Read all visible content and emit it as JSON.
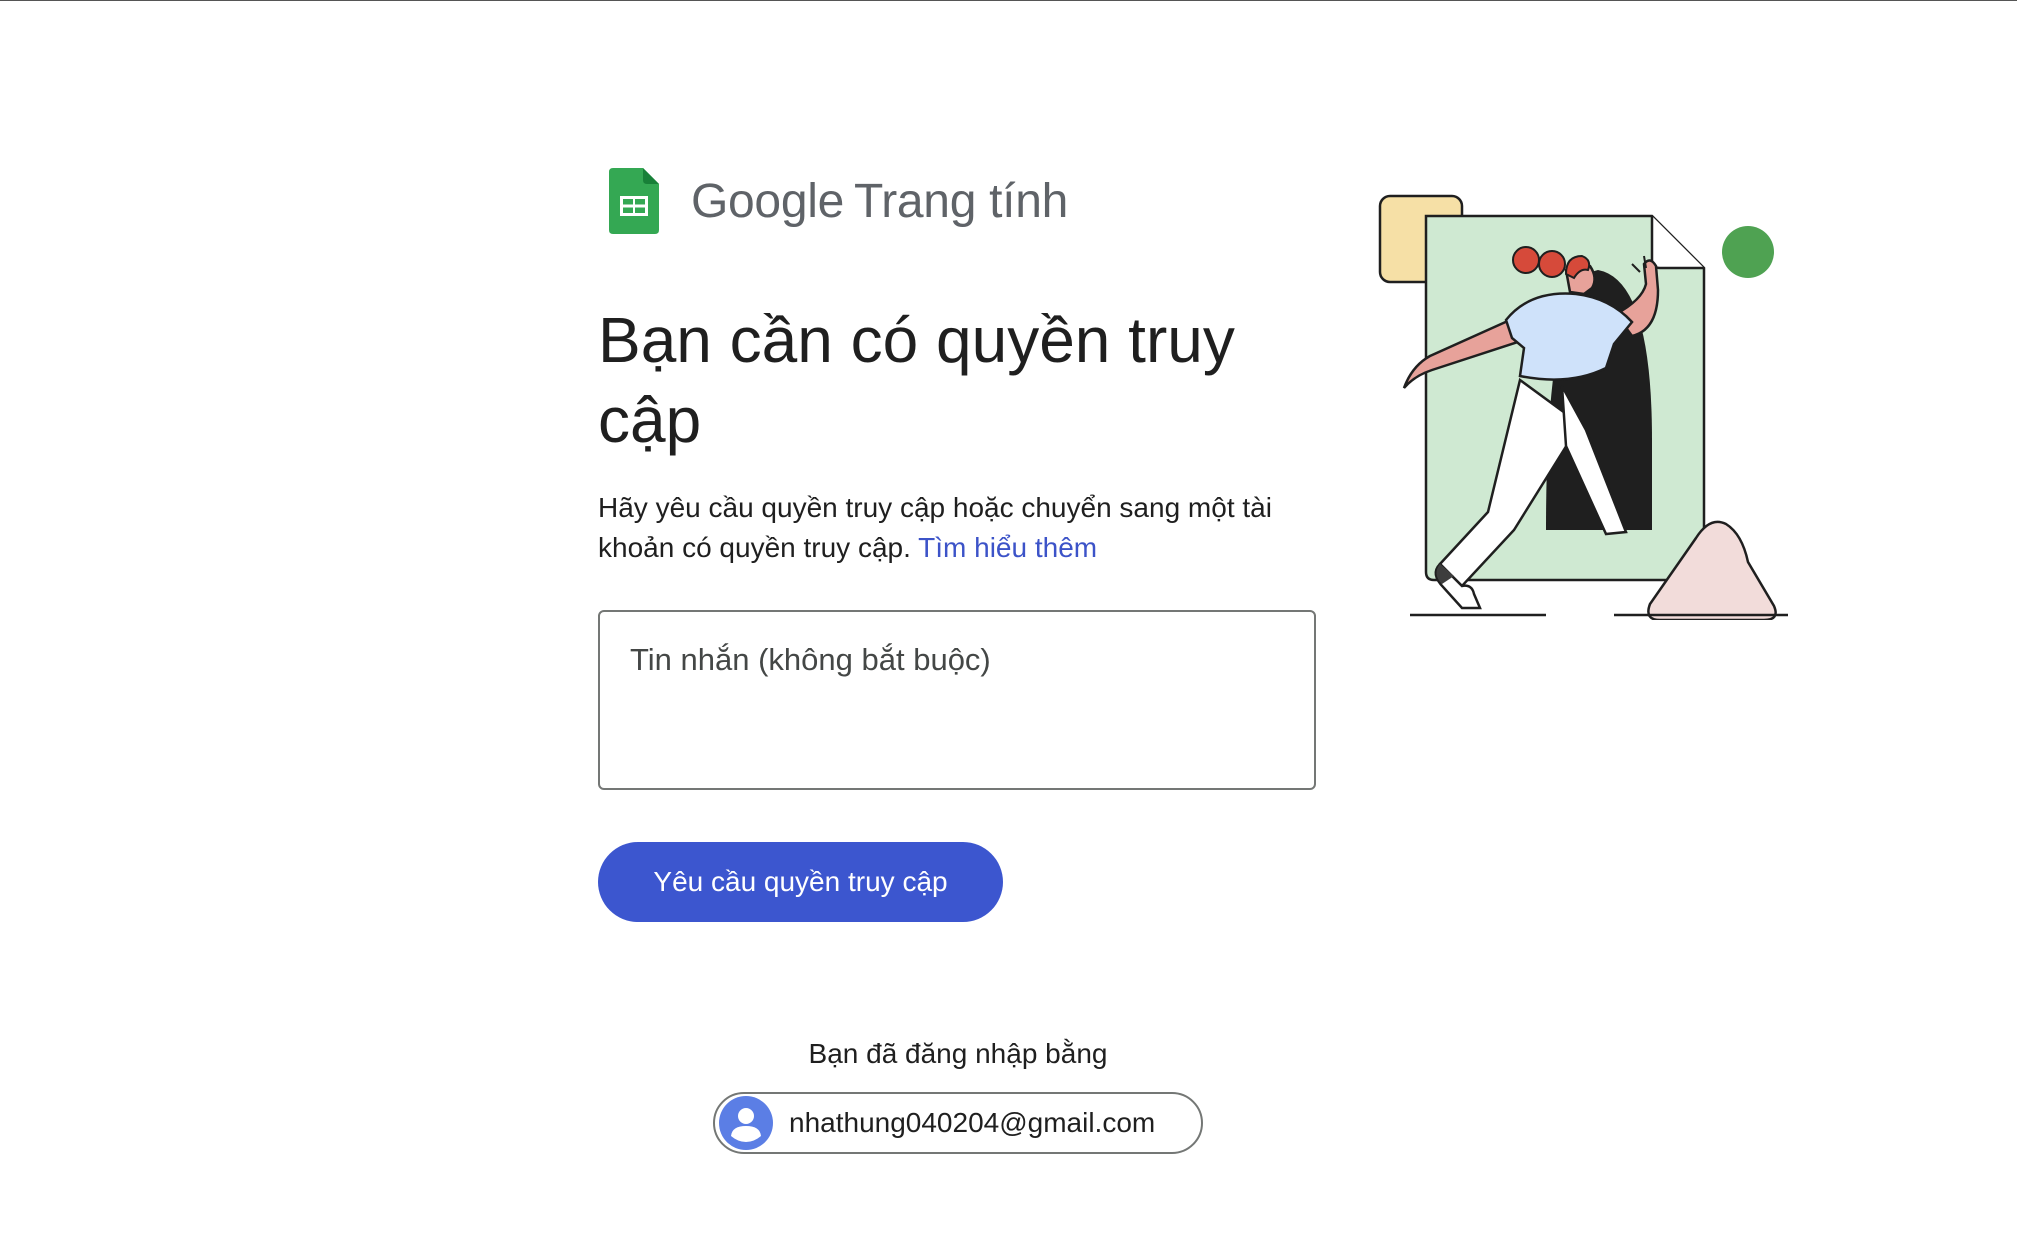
{
  "brand": {
    "google": "Google",
    "product": "Trang tính"
  },
  "main": {
    "heading": "Bạn cần có quyền truy cập",
    "description": "Hãy yêu cầu quyền truy cập hoặc chuyển sang một tài khoản có quyền truy cập.",
    "learn_more": "Tìm hiểu thêm",
    "message_placeholder": "Tin nhắn (không bắt buộc)",
    "request_button": "Yêu cầu quyền truy cập"
  },
  "account": {
    "signed_in_label": "Bạn đã đăng nhập bằng",
    "email": "nhathung040204@gmail.com"
  },
  "icons": {
    "product": "google-sheets-icon",
    "avatar": "account-avatar-icon"
  },
  "colors": {
    "primary": "#3c56cf",
    "link": "#3c53c8",
    "sheets_green": "#34a853"
  }
}
